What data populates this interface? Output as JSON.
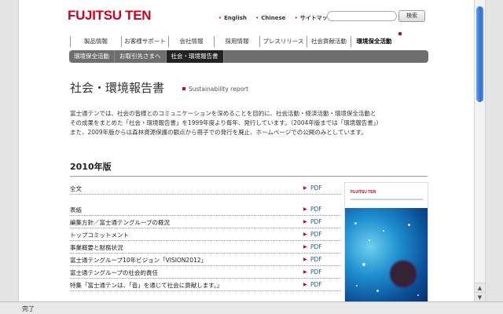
{
  "header": {
    "logo_text": "FUJITSU TEN",
    "utility_links": [
      "English",
      "Chinese",
      "サイトマップ"
    ],
    "search_placeholder": "",
    "search_button": "検索"
  },
  "global_nav": {
    "items": [
      {
        "label": "製品情報",
        "width": 66
      },
      {
        "label": "お客様サポート",
        "width": 60
      },
      {
        "label": "会社情報",
        "width": 58
      },
      {
        "label": "採用情報",
        "width": 58
      },
      {
        "label": "プレスリリース",
        "width": 60
      },
      {
        "label": "社会貢献活動",
        "width": 56
      },
      {
        "label": "環境保全活動",
        "width": 58
      }
    ]
  },
  "sub_nav": {
    "items": [
      "環境保全活動",
      "お取引先さまへ",
      "社会・環境報告書"
    ],
    "active_index": 2
  },
  "page": {
    "title": "社会・環境報告書",
    "title_en": "Sustainability report",
    "intro_lines": [
      "富士通テンでは、社会の皆様とのコミュニケーションを深めることを目的に、社会活動・経済活動・環境保全活動と",
      "その成果をまとめた「社会・環境報告書」を1999年度より毎年、発行しています。（2004年版までは「環境報告書」）",
      "また、2009年版からは森林資源保護の観点から冊子での発行を廃止、ホームページでの公開のみとしています。"
    ],
    "year_heading": "2010年版"
  },
  "documents": [
    {
      "label": "全文",
      "link": "PDF",
      "gap_after": true
    },
    {
      "label": "表紙",
      "link": "PDF",
      "gap_after": false
    },
    {
      "label": "編集方針／富士通テングループの概況",
      "link": "PDF",
      "gap_after": false
    },
    {
      "label": "トップコミットメント",
      "link": "PDF",
      "gap_after": false
    },
    {
      "label": "事業概要と財務状況",
      "link": "PDF",
      "gap_after": false
    },
    {
      "label": "富士通テングループ10年ビジョン「VISION2012」",
      "link": "PDF",
      "gap_after": false
    },
    {
      "label": "富士通テングループの社会的責任",
      "link": "PDF",
      "gap_after": false
    },
    {
      "label": "特集「富士通テンは、「音」を通じて社会に貢献します。」",
      "link": "PDF",
      "gap_after": false
    }
  ],
  "cover": {
    "logo_text": "FUJITSU TEN"
  },
  "status_bar": {
    "text": "完了"
  },
  "colors": {
    "brand_red": "#d2001f",
    "link_blue": "#2a5aa8",
    "subnav_bg": "#6e6e6e"
  }
}
